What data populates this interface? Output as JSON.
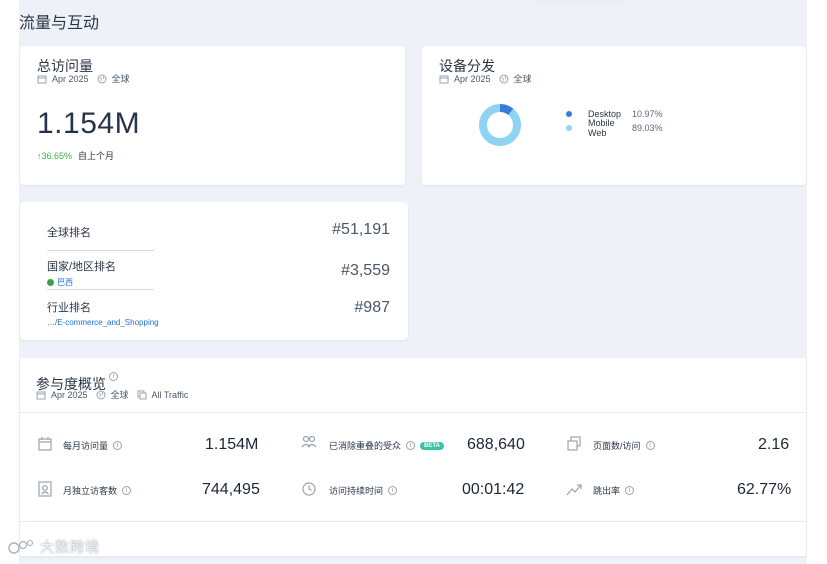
{
  "section_title": "流量与互动",
  "visits_card": {
    "title": "总访问量",
    "date": "Apr 2025",
    "region": "全球",
    "total": "1.154M",
    "change": "↑36.65%",
    "change_label": "自上个月"
  },
  "device_card": {
    "title": "设备分发",
    "date": "Apr 2025",
    "region": "全球",
    "chart_data": {
      "type": "pie",
      "categories": [
        "Desktop",
        "Mobile Web"
      ],
      "values": [
        10.97,
        89.03
      ],
      "colors": [
        "#3a7bd5",
        "#8fd3f4"
      ],
      "labels": [
        "10.97%",
        "89.03%"
      ]
    }
  },
  "ranking_card": {
    "global_label": "全球排名",
    "global_value": "#51,191",
    "country_label": "国家/地区排名",
    "country_name": "巴西",
    "country_value": "#3,559",
    "industry_label": "行业排名",
    "industry_path": "…/E-commerce_and_Shopping",
    "industry_value": "#987"
  },
  "engagement": {
    "title": "参与度概览",
    "date": "Apr 2025",
    "region": "全球",
    "traffic": "All Traffic",
    "beta_badge": "BETA",
    "metrics": {
      "monthly_visits_label": "每月访问量",
      "monthly_visits_value": "1.154M",
      "dedup_audience_label": "已消除重叠的受众",
      "dedup_audience_value": "688,640",
      "pages_per_visit_label": "页面数/访问",
      "pages_per_visit_value": "2.16",
      "unique_visitors_label": "月独立访客数",
      "unique_visitors_value": "744,495",
      "visit_duration_label": "访问持续时间",
      "visit_duration_value": "00:01:42",
      "bounce_rate_label": "跳出率",
      "bounce_rate_value": "62.77%"
    }
  },
  "watermark": "大数跨境",
  "accent_colors": {
    "up": "#3ab549",
    "link": "#1f6fd6",
    "beta": "#3cc3a3"
  }
}
